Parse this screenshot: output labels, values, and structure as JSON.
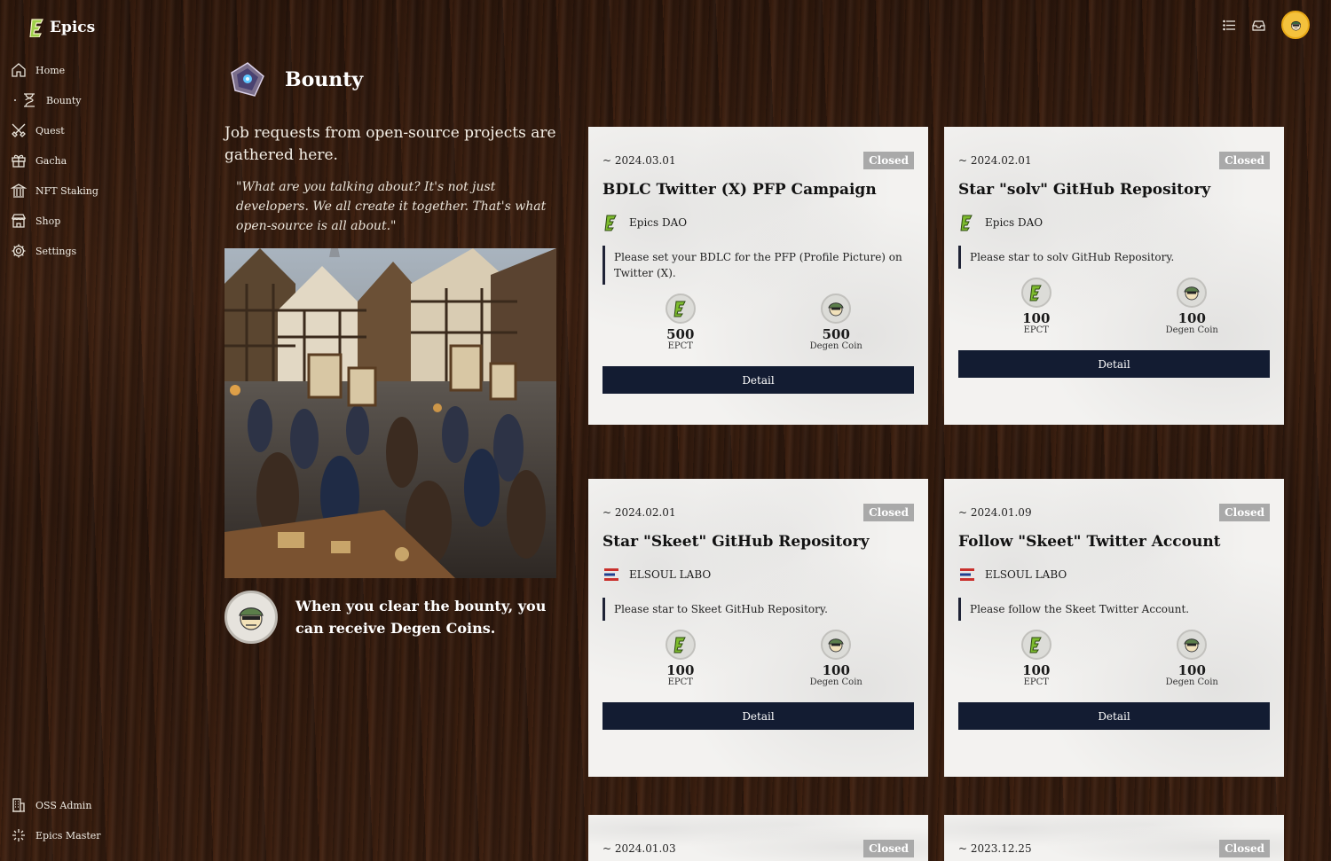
{
  "app": {
    "name": "Epics"
  },
  "sidebar": {
    "items": [
      {
        "label": "Home",
        "icon": "home-icon"
      },
      {
        "label": "Bounty",
        "icon": "hourglass-icon"
      },
      {
        "label": "Quest",
        "icon": "swords-icon"
      },
      {
        "label": "Gacha",
        "icon": "gift-icon"
      },
      {
        "label": "NFT Staking",
        "icon": "bank-icon"
      },
      {
        "label": "Shop",
        "icon": "store-icon"
      },
      {
        "label": "Settings",
        "icon": "gear-icon"
      }
    ],
    "bottom": [
      {
        "label": "OSS Admin",
        "icon": "building-icon"
      },
      {
        "label": "Epics Master",
        "icon": "sparkle-icon"
      }
    ]
  },
  "page": {
    "title": "Bounty",
    "description": "Job requests from open-source projects are gathered here.",
    "quote": "\"What are you talking about? It's not just developers. We all create it together. That's what open-source is all about.\"",
    "reward_note": "When you clear the bounty, you can receive Degen Coins."
  },
  "cards": [
    {
      "date": "~ 2024.03.01",
      "status": "Closed",
      "title": "BDLC Twitter (X) PFP Campaign",
      "org": "Epics DAO",
      "desc": "Please set your BDLC for the PFP (Profile Picture) on Twitter (X).",
      "epct": "500",
      "epct_label": "EPCT",
      "degen": "500",
      "degen_label": "Degen Coin",
      "button": "Detail"
    },
    {
      "date": "~ 2024.02.01",
      "status": "Closed",
      "title": "Star \"solv\" GitHub Repository",
      "org": "Epics DAO",
      "desc": "Please star to solv GitHub Repository.",
      "epct": "100",
      "epct_label": "EPCT",
      "degen": "100",
      "degen_label": "Degen Coin",
      "button": "Detail"
    },
    {
      "date": "~ 2024.02.01",
      "status": "Closed",
      "title": "Star \"Skeet\" GitHub Repository",
      "org": "ELSOUL LABO",
      "desc": "Please star to Skeet GitHub Repository.",
      "epct": "100",
      "epct_label": "EPCT",
      "degen": "100",
      "degen_label": "Degen Coin",
      "button": "Detail"
    },
    {
      "date": "~ 2024.01.09",
      "status": "Closed",
      "title": "Follow \"Skeet\" Twitter Account",
      "org": "ELSOUL LABO",
      "desc": "Please follow the Skeet Twitter Account.",
      "epct": "100",
      "epct_label": "EPCT",
      "degen": "100",
      "degen_label": "Degen Coin",
      "button": "Detail"
    },
    {
      "date": "~ 2024.01.03",
      "status": "Closed"
    },
    {
      "date": "~ 2023.12.25",
      "status": "Closed"
    }
  ],
  "colors": {
    "button": "#131c32",
    "badge": "#a9a9a9",
    "card": "#f3f2f0",
    "accent_green": "#7dbb2e"
  }
}
